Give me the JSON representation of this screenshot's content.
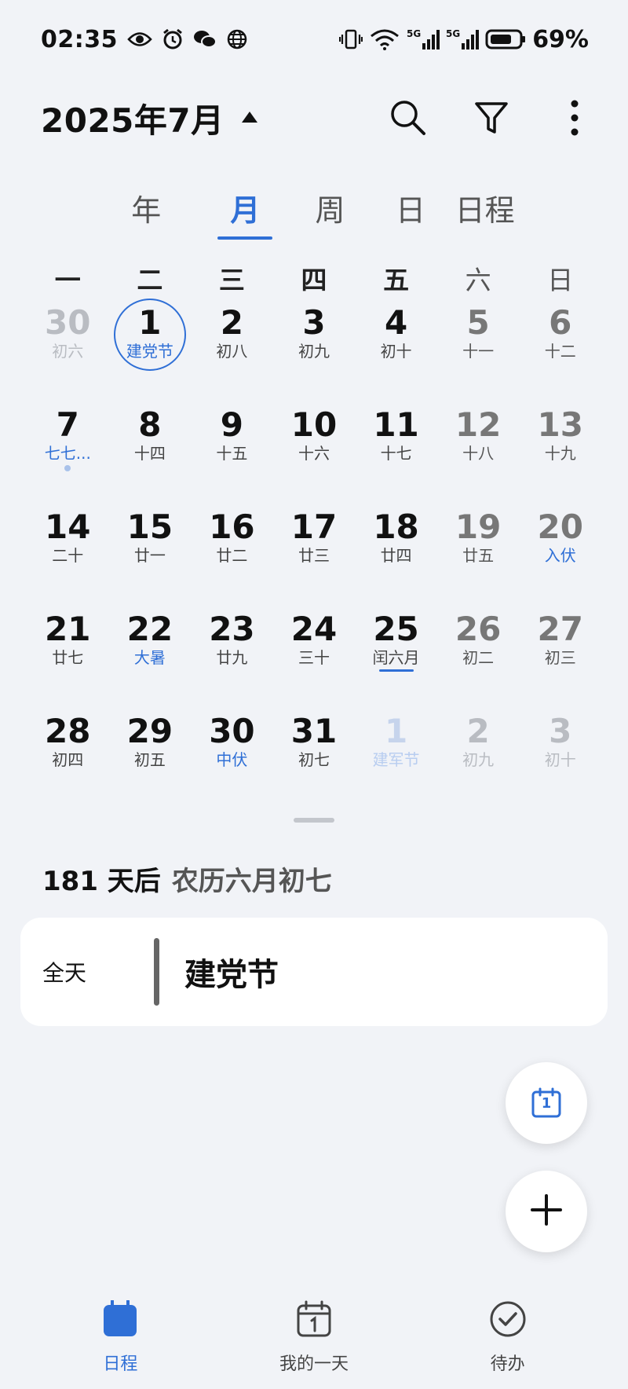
{
  "status_bar": {
    "time": "02:35",
    "battery": "69%",
    "left_icons": [
      "eye-icon",
      "alarm-icon",
      "wechat-icon",
      "globe-icon"
    ],
    "right_icons": [
      "vibrate-icon",
      "wifi-icon",
      "signal-5g-icon",
      "signal-5g-icon",
      "battery-icon"
    ]
  },
  "header": {
    "title": "2025年7月"
  },
  "view_tabs": [
    {
      "label": "年",
      "active": false
    },
    {
      "label": "月",
      "active": true
    },
    {
      "label": "周",
      "active": false
    },
    {
      "label": "日",
      "active": false
    },
    {
      "label": "日程",
      "active": false
    }
  ],
  "weekdays": [
    "一",
    "二",
    "三",
    "四",
    "五",
    "六",
    "日"
  ],
  "calendar": {
    "weeks": [
      [
        {
          "num": "30",
          "sub": "初六",
          "other": true
        },
        {
          "num": "1",
          "sub": "建党节",
          "today": true
        },
        {
          "num": "2",
          "sub": "初八"
        },
        {
          "num": "3",
          "sub": "初九"
        },
        {
          "num": "4",
          "sub": "初十"
        },
        {
          "num": "5",
          "sub": "十一",
          "weekend": true
        },
        {
          "num": "6",
          "sub": "十二",
          "weekend": true
        }
      ],
      [
        {
          "num": "7",
          "sub": "七七...",
          "blue": true,
          "dot": true
        },
        {
          "num": "8",
          "sub": "十四"
        },
        {
          "num": "9",
          "sub": "十五"
        },
        {
          "num": "10",
          "sub": "十六"
        },
        {
          "num": "11",
          "sub": "十七"
        },
        {
          "num": "12",
          "sub": "十八",
          "weekend": true
        },
        {
          "num": "13",
          "sub": "十九",
          "weekend": true
        }
      ],
      [
        {
          "num": "14",
          "sub": "二十"
        },
        {
          "num": "15",
          "sub": "廿一"
        },
        {
          "num": "16",
          "sub": "廿二"
        },
        {
          "num": "17",
          "sub": "廿三"
        },
        {
          "num": "18",
          "sub": "廿四"
        },
        {
          "num": "19",
          "sub": "廿五",
          "weekend": true
        },
        {
          "num": "20",
          "sub": "入伏",
          "weekend": true,
          "blue": true
        }
      ],
      [
        {
          "num": "21",
          "sub": "廿七"
        },
        {
          "num": "22",
          "sub": "大暑",
          "blue": true
        },
        {
          "num": "23",
          "sub": "廿九"
        },
        {
          "num": "24",
          "sub": "三十"
        },
        {
          "num": "25",
          "sub": "闰六月",
          "underline": true
        },
        {
          "num": "26",
          "sub": "初二",
          "weekend": true
        },
        {
          "num": "27",
          "sub": "初三",
          "weekend": true
        }
      ],
      [
        {
          "num": "28",
          "sub": "初四"
        },
        {
          "num": "29",
          "sub": "初五"
        },
        {
          "num": "30",
          "sub": "中伏",
          "blue": true
        },
        {
          "num": "31",
          "sub": "初七"
        },
        {
          "num": "1",
          "sub": "建军节",
          "other": true,
          "holiday": true
        },
        {
          "num": "2",
          "sub": "初九",
          "other": true
        },
        {
          "num": "3",
          "sub": "初十",
          "other": true
        }
      ]
    ]
  },
  "info": {
    "days_after": "181 天后",
    "lunar": "农历六月初七"
  },
  "event": {
    "allday_label": "全天",
    "title": "建党节"
  },
  "fab": {
    "today_number": "1"
  },
  "bottom_nav": [
    {
      "label": "日程",
      "icon": "calendar-icon",
      "active": true
    },
    {
      "label": "我的一天",
      "icon": "my-day-icon",
      "active": false
    },
    {
      "label": "待办",
      "icon": "todo-check-icon",
      "active": false
    }
  ],
  "colors": {
    "accent": "#2f6fd6",
    "background": "#f1f3f7",
    "card": "#ffffff"
  }
}
